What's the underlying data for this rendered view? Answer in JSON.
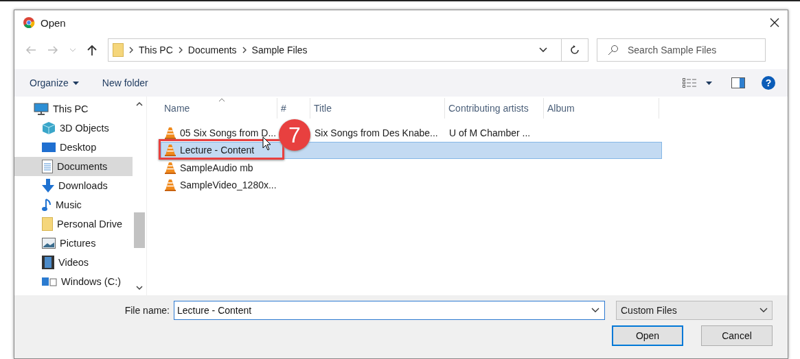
{
  "window": {
    "title": "Open"
  },
  "address": {
    "path": [
      "This PC",
      "Documents",
      "Sample Files"
    ]
  },
  "search": {
    "placeholder": "Search Sample Files"
  },
  "toolbar": {
    "organize": "Organize",
    "new_folder": "New folder",
    "help": "?"
  },
  "sidebar": {
    "items": [
      {
        "label": "This PC",
        "kind": "pc",
        "selected": false,
        "children": [
          {
            "label": "3D Objects",
            "kind": "objects",
            "selected": false
          },
          {
            "label": "Desktop",
            "kind": "desktop",
            "selected": false
          },
          {
            "label": "Documents",
            "kind": "documents",
            "selected": true
          },
          {
            "label": "Downloads",
            "kind": "downloads",
            "selected": false
          },
          {
            "label": "Music",
            "kind": "music",
            "selected": false
          },
          {
            "label": "Personal Drive",
            "kind": "folder",
            "selected": false
          },
          {
            "label": "Pictures",
            "kind": "pictures",
            "selected": false
          },
          {
            "label": "Videos",
            "kind": "videos",
            "selected": false
          },
          {
            "label": "Windows (C:)",
            "kind": "drive",
            "selected": false
          }
        ]
      }
    ]
  },
  "table": {
    "columns": [
      "Name",
      "#",
      "Title",
      "Contributing artists",
      "Album"
    ],
    "rows": [
      {
        "cells": [
          "05 Six Songs from D...",
          "",
          "Six Songs from Des Knabe...",
          "U of M Chamber ...",
          ""
        ],
        "selected": false
      },
      {
        "cells": [
          "Lecture - Content",
          "",
          "",
          "",
          ""
        ],
        "selected": true
      },
      {
        "cells": [
          "SampleAudio mb",
          "",
          "",
          "",
          ""
        ],
        "selected": false
      },
      {
        "cells": [
          "SampleVideo_1280x...",
          "",
          "",
          "",
          ""
        ],
        "selected": false
      }
    ]
  },
  "annotation": {
    "number": "7"
  },
  "file_name": {
    "label": "File name:",
    "value": "Lecture - Content"
  },
  "file_type": {
    "value": "Custom Files"
  },
  "buttons": [
    {
      "label": "Open",
      "kind": "primary"
    },
    {
      "label": "Cancel",
      "kind": "normal"
    }
  ]
}
